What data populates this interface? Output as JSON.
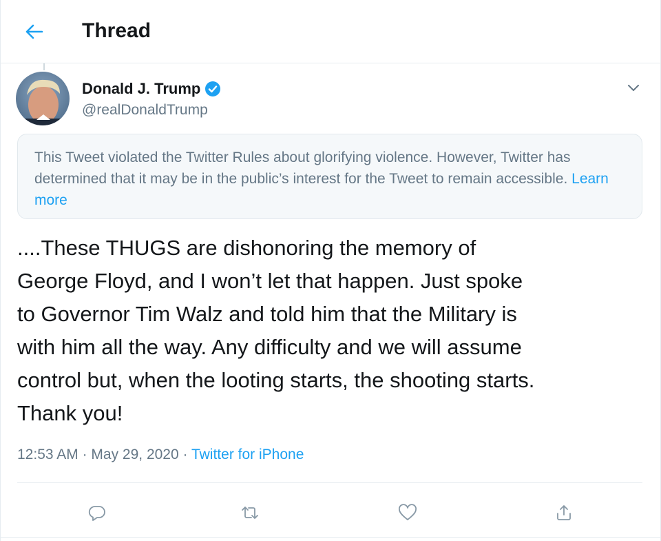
{
  "header": {
    "back_icon": "arrow-left-icon",
    "title": "Thread"
  },
  "tweet": {
    "author": {
      "display_name": "Donald J. Trump",
      "handle": "@realDonaldTrump",
      "verified": true,
      "avatar_icon": "profile-photo"
    },
    "menu_icon": "chevron-down-icon",
    "notice": {
      "text": "This Tweet violated the Twitter Rules about glorifying violence. However, Twitter has determined that it may be in the public’s interest for the Tweet to remain accessible.",
      "link_text": "Learn more"
    },
    "body_lines": [
      "....These THUGS are dishonoring the memory of",
      "George Floyd, and I won’t let that happen. Just spoke",
      "to Governor Tim Walz and told him that the Military is",
      "with him all the way. Any difficulty and we will assume",
      "control but, when the looting starts, the shooting starts.",
      "Thank you!"
    ],
    "time": "12:53 AM",
    "separator": "·",
    "date": "May 29, 2020",
    "source": "Twitter for iPhone"
  },
  "actions": [
    {
      "name": "reply",
      "icon": "reply-icon"
    },
    {
      "name": "retweet",
      "icon": "retweet-icon"
    },
    {
      "name": "like",
      "icon": "heart-icon"
    },
    {
      "name": "share",
      "icon": "share-icon"
    }
  ],
  "colors": {
    "accent": "#1da1f2",
    "text": "#14171a",
    "secondary": "#657786",
    "notice_bg": "#f5f8fa",
    "border": "#e6ecf0"
  }
}
